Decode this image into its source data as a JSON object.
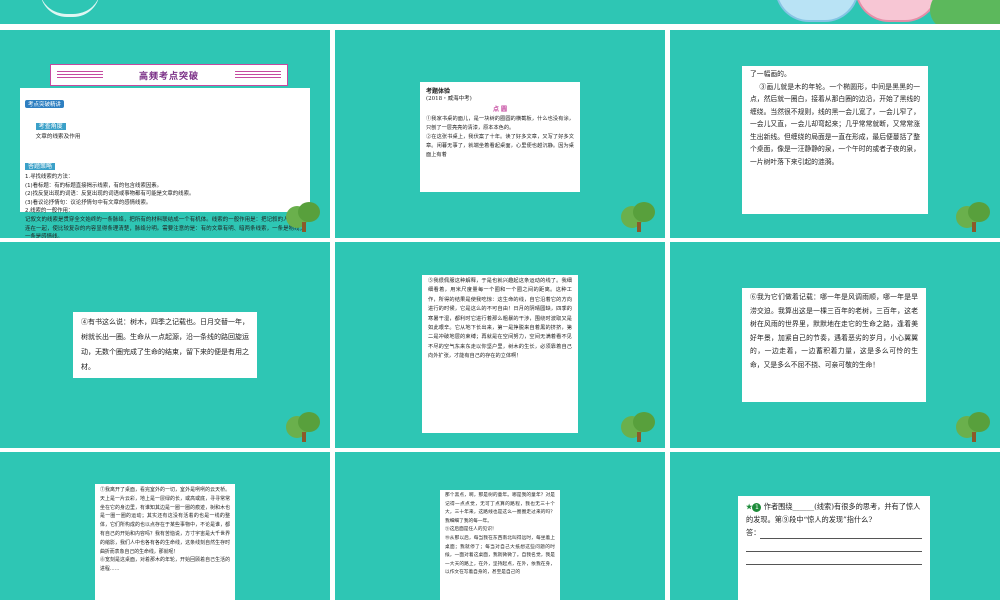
{
  "colors": {
    "slide_bg": "#2ec6b4",
    "accent_magenta": "#c54aa0",
    "text": "#222222"
  },
  "slide1": {
    "banner": "高频考点突破",
    "tag": "考点突破精讲",
    "point_label": "考查角度",
    "point_text": "文章的线索及作用",
    "strategy_label": "答题策略",
    "body": "1.寻找线索的方法：\n(1)看标题：有的标题直接揭示线索，有的包含线索因素。\n(2)找反复出现的词语：反复出现的词语或事物都有可能是文章的线索。\n(3)看议论抒情句：议论抒情句中有文章的感情线索。\n2.线索的一般作用：\n记叙文的线索是贯穿全文始终的一条脉络，把所有的材料联结成一个有机体。线索的一般作用是：把记叙的人物事件连在一起，使比较复杂的内容显得条理清楚，脉络分明。需要注意的是：有的文章有明、暗两条线索，一条是物线，一条是感情线。"
  },
  "slide2": {
    "tag": "考题体验",
    "source": "(2018・威海中考)",
    "heading": "点  圆",
    "body": "①我家书桌的面儿，是一块树的圈圆的横截板，什么也没有涂，只刨了一层亮亮的清漆，原本本色的。\n②在这张书桌上，我伏案了十年。读了好多文章，又写了好多文章。闲暮无事了，就端坐着看起桌面，心里便也越沉静。因为桌面上有着"
  },
  "slide3": {
    "body": "了一幅画的。\n    ③画儿就是木的年轮。一个椭圆形，中间是黑黑的一点，然后就一圈白，接着从那白圈的边沿，开始了黑线的缠绕。当然很不规则，线的黑一会儿宽了，一会儿窄了，一会儿又直，一会儿却弯起来；几乎常常就断，又常常涨生出新线。但缠绕的局面是一直在形成，最后便蔓括了整个桌面，像是一汪静静的泉，一个午时的或者子夜的泉，一片树叶落下来引起的涟漪。"
  },
  "slide4": {
    "body": "④有书这么说：树木，四季之记载也。日月交替一年，树就长出一圈。生命从一点起源，沿一条线的路回旋运动，无数个圈完成了生命的结束，留下来的便是有用之材。"
  },
  "slide5": {
    "body": "⑤我很佩服这种解释，于是也就兴趣起这条运动的线了。我细细看着，用米尺度量每一个圈和一个圈之间的距离。这种工作，所得的结果是使我吃惊：这生命的线，自它沿着它的方向进行的时候，它是这么的不可自由！日月的阴晴圆缺，四季的寒暑干湿，都利时它进行着那么粗暴的干涉，围绕时波取又是如此艰辛。它从地下长出来，第一是挣脱来自着黑的挤挤，第二是冲破地层的束缚；再就是在空间努力，空间无满着看不见不尽的空气东来东走以你坚户里，树木的生长，必须靠着自己向外扩张，才能有自己的存在的立体啊！"
  },
  "slide6": {
    "body": "⑥我为它们做着记载：哪一年是风调雨顺，哪一年是旱涝交迫。我算出这是一棵三百年的老树，三百年，这老树在风雨的世界里，默默地在走它的生命之路，逢着美好年景，加紧自己的节奏，遇着恶劣的岁月，小心翼翼的，一边走着，一边蓄积着力量，这是多么可怜的生命，又是多么不屈不挠、可亲可敬的生命！"
  },
  "slide7": {
    "body": "⑦我离开了桌面，看完室外的一切，室外是咧咧的云天桥。天上是一片云彩，地上是一层绿的长，或高或底，寻寻常常坐在它的身边里，有谁知其边是一圈一圈的痕迹，树和木也是一圈一圈的运动；其实还有这没有活着的也是一线的整体，它们所构成的也以点存在于某些事物中，不论是谁，都有自己的开始和内容吗？我有苦恼说，方寸宇宙是大千世界的缩影，我们人中也各有各的生命线，这条线刻自然生存时曲折而表象自己的生命线，那就呢！\n⑧宽刻是这桌面，对着那木的年轮，开始回顾着自己生活的进程……"
  },
  "slide8": {
    "body": "那个黑点，啊，那是树的童年。哪是我的童年？对是记得一点点觉，无可丁点算的路程，我也无三十个大，三十年来，这路线也是这么一圈圈走过来的吗？我细细了我的每一年。\n⑨这后面是任人的见识！\n⑩从那以后，每当我在东西南北叫得远时，每坐着上桌面；我就停了；每当对自己大抵想这些问题的时候，一面对着这桌面，我就微微了。自我名觉，我是一大天的路上，在外，坚持起点，在外，依我在身，以作文在写着自身的，甚至是自己的"
  },
  "slide9": {
    "q_num": "1",
    "question": "作者围绕______(线索)有很多的思考，并有了惊人的发现。第⑨段中“惊人的发现”指什么?",
    "answer_label": "答："
  }
}
